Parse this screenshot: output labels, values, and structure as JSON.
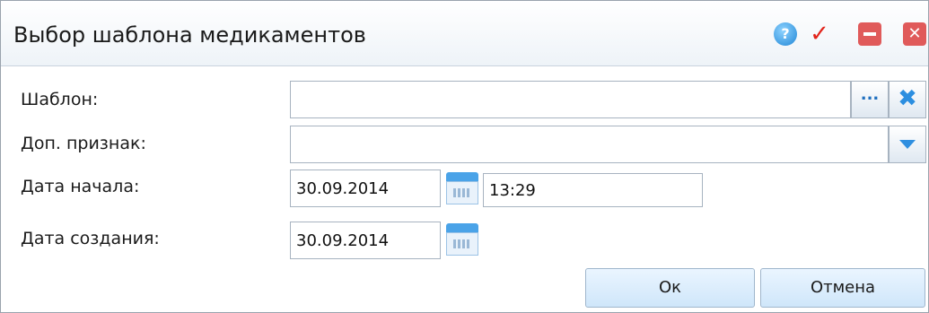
{
  "window": {
    "title": "Выбор шаблона медикаментов",
    "icons": [
      "help-icon",
      "check-icon",
      "minimize-icon",
      "close-icon"
    ],
    "colors": {
      "accent": "#2f8fe0",
      "window_button": "#e05a5a"
    }
  },
  "form": {
    "template": {
      "label": "Шаблон:",
      "value": "",
      "browse_label": "..."
    },
    "extra_attribute": {
      "label": "Доп. признак:",
      "value": ""
    },
    "start_date": {
      "label": "Дата начала:",
      "date": "30.09.2014",
      "time": "13:29"
    },
    "created_date": {
      "label": "Дата создания:",
      "date": "30.09.2014"
    }
  },
  "buttons": {
    "ok": "Ок",
    "cancel": "Отмена"
  }
}
